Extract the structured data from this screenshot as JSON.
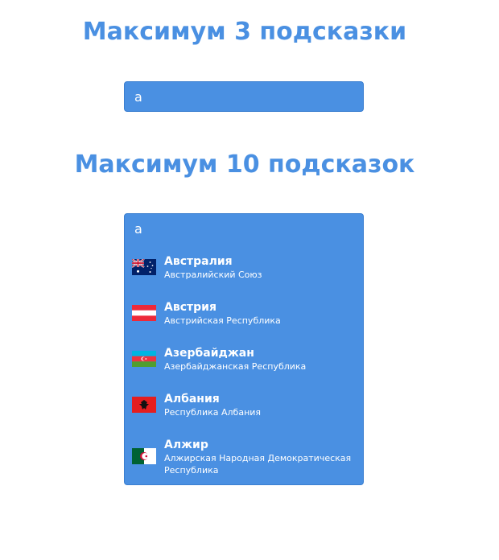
{
  "section1": {
    "title": "Максимум 3 подсказки",
    "input_value": "a"
  },
  "section2": {
    "title": "Максимум 10 подсказок",
    "input_value": "a",
    "suggestions": [
      {
        "name": "Австралия",
        "full_name": "Австралийский Союз",
        "flag": "flag-australia-icon"
      },
      {
        "name": "Австрия",
        "full_name": "Австрийская Республика",
        "flag": "flag-austria-icon"
      },
      {
        "name": "Азербайджан",
        "full_name": "Азербайджанская Республика",
        "flag": "flag-azerbaijan-icon"
      },
      {
        "name": "Албания",
        "full_name": "Республика Албания",
        "flag": "flag-albania-icon"
      },
      {
        "name": "Алжир",
        "full_name": "Алжирская Народная Демократическая Республика",
        "flag": "flag-algeria-icon"
      }
    ]
  },
  "colors": {
    "accent": "#4a90e2",
    "text_on_accent": "#ffffff"
  }
}
